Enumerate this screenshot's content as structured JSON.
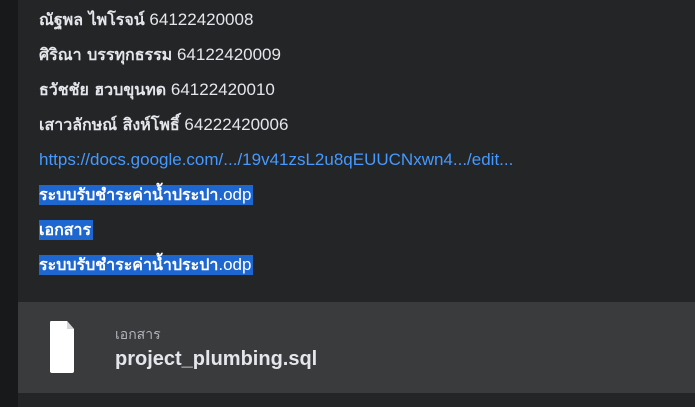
{
  "message": {
    "members": [
      {
        "name": "ณัฐพล ไพโรจน์",
        "id": "64122420008"
      },
      {
        "name": "ศิริณา บรรทุกธรรม",
        "id": "64122420009"
      },
      {
        "name": "ธวัชชัย ฮวบขุนทด",
        "id": "64122420010"
      },
      {
        "name": "เสาวลักษณ์ สิงห์โพธิ์",
        "id": "64222420006"
      }
    ],
    "link_text": "https://docs.google.com/.../19v41zsL2u8qEUUCNxwn4.../edit...",
    "selected_lines": [
      {
        "base": "ระบบรับชำระค่าน้ำประปา",
        "ext": ".odp"
      },
      {
        "base": "เอกสาร",
        "ext": ""
      },
      {
        "base": "ระบบรับชำระค่าน้ำประปา",
        "ext": ".odp"
      }
    ]
  },
  "attachment": {
    "type_label": "เอกสาร",
    "file_name": "project_plumbing.sql",
    "icon": "file-icon"
  },
  "colors": {
    "background": "#242526",
    "selection": "#1e66d0",
    "link": "#4599ff",
    "attachment_bg": "#3a3b3c"
  }
}
